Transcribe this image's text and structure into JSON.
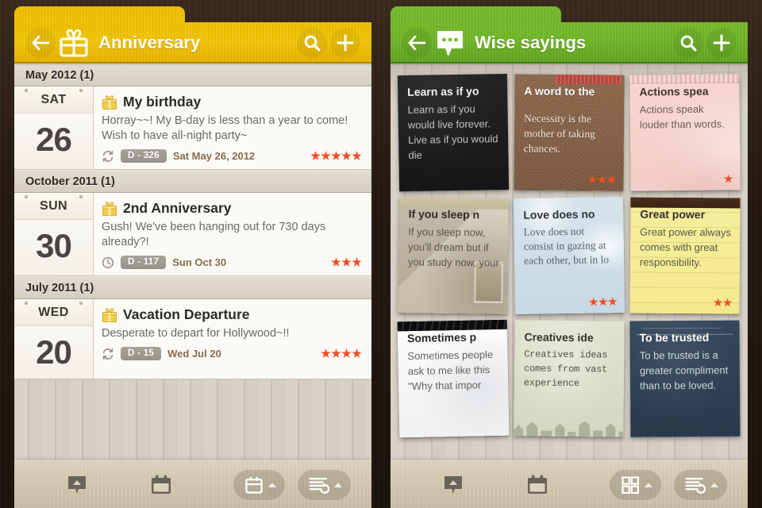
{
  "left_app": {
    "header": {
      "title": "Anniversary",
      "accent_color": "#f0c200",
      "back_icon": "back-arrow-icon",
      "app_icon": "gift-icon",
      "search_icon": "search-icon",
      "add_icon": "plus-icon"
    },
    "sections": [
      {
        "header": "May 2012 (1)",
        "events": [
          {
            "dow": "SAT",
            "day": "26",
            "icon": "gift-icon",
            "title": "My birthday",
            "description": "Horray~~! My B-day is less than a year to come! Wish to have all-night party~",
            "repeat_icon": "repeat-icon",
            "badge": "D - 326",
            "date": "Sat May 26, 2012",
            "rating": 5
          }
        ]
      },
      {
        "header": "October 2011 (1)",
        "events": [
          {
            "dow": "SUN",
            "day": "30",
            "icon": "gift-icon",
            "title": "2nd Anniversary",
            "description": "Gush! We've been hanging out for 730 days already?!",
            "repeat_icon": "clock-icon",
            "badge": "D - 117",
            "date": "Sun Oct 30",
            "rating": 3
          }
        ]
      },
      {
        "header": "July 2011 (1)",
        "events": [
          {
            "dow": "WED",
            "day": "20",
            "icon": "gift-icon",
            "title": "Vacation Departure",
            "description": "Desperate to depart for Hollywood~!!",
            "repeat_icon": "repeat-icon",
            "badge": "D - 15",
            "date": "Wed Jul 20",
            "rating": 4
          }
        ]
      }
    ],
    "toolbar": [
      {
        "icon": "speech-bubble-up-icon",
        "type": "icon"
      },
      {
        "icon": "calendar-icon",
        "type": "icon"
      },
      {
        "icon": "calendar-view-icon",
        "type": "pill"
      },
      {
        "icon": "list-sort-icon",
        "type": "pill"
      }
    ]
  },
  "right_app": {
    "header": {
      "title": "Wise sayings",
      "accent_color": "#79bd2c",
      "back_icon": "back-arrow-icon",
      "app_icon": "speech-bubble-icon",
      "search_icon": "search-icon",
      "add_icon": "plus-icon"
    },
    "cards": [
      {
        "title": "Learn as if yo",
        "body": "Learn as if you would live forever. Live as if you would die",
        "rating": 0,
        "skin": "sk-black"
      },
      {
        "title": "A word to the",
        "body": "Necessity is the mother of taking chances.",
        "rating": 3,
        "skin": "sk-cork"
      },
      {
        "title": "Actions spea",
        "body": "Actions speak louder than words.",
        "rating": 1,
        "skin": "sk-pink"
      },
      {
        "title": "If you sleep n",
        "body": "If you sleep now, you'll dream but if you study now, your",
        "rating": 0,
        "skin": "sk-photo"
      },
      {
        "title": "Love does no",
        "body": "Love does not consist in gazing at each other, but in lo",
        "rating": 3,
        "skin": "sk-blue"
      },
      {
        "title": "Great power",
        "body": "Great power always comes with great responsibility.",
        "rating": 2,
        "skin": "sk-legal"
      },
      {
        "title": "Sometimes p",
        "body": "Sometimes people ask to me like this \"Why that impor",
        "rating": 0,
        "skin": "sk-white"
      },
      {
        "title": "Creatives ide",
        "body": "Creatives ideas comes from vast experience",
        "rating": 0,
        "skin": "sk-sage"
      },
      {
        "title": "To be trusted",
        "body": "To be trusted is a greater compliment than to be loved.",
        "rating": 0,
        "skin": "sk-navy"
      }
    ],
    "toolbar": [
      {
        "icon": "speech-bubble-up-icon",
        "type": "icon"
      },
      {
        "icon": "calendar-icon",
        "type": "icon"
      },
      {
        "icon": "grid-view-icon",
        "type": "pill"
      },
      {
        "icon": "list-sort-icon",
        "type": "pill"
      }
    ]
  },
  "colors": {
    "star": "#f04e23",
    "badge": "#a09a90",
    "date_text": "#8a6a4d"
  }
}
